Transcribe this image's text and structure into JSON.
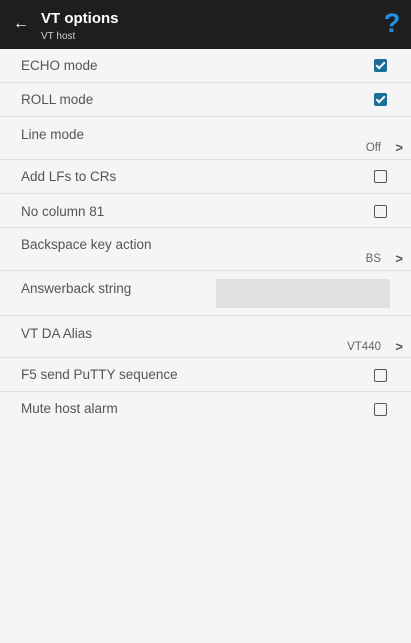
{
  "header": {
    "back_glyph": "←",
    "title": "VT options",
    "subtitle": "VT host",
    "help_glyph": "?",
    "help_color": "#1f8fe6"
  },
  "items": [
    {
      "label": "ECHO mode",
      "type": "checkbox",
      "checked": true
    },
    {
      "label": "ROLL mode",
      "type": "checkbox",
      "checked": true
    },
    {
      "label": "Line mode",
      "type": "select",
      "value": "Off",
      "chevron": ">"
    },
    {
      "label": "Add LFs to CRs",
      "type": "checkbox",
      "checked": false
    },
    {
      "label": "No column 81",
      "type": "checkbox",
      "checked": false
    },
    {
      "label": "Backspace key action",
      "type": "select",
      "value": "BS",
      "chevron": ">"
    },
    {
      "label": "Answerback string",
      "type": "text",
      "value": ""
    },
    {
      "label": "VT DA Alias",
      "type": "select",
      "value": "VT440",
      "chevron": ">"
    },
    {
      "label": "F5 send PuTTY sequence",
      "type": "checkbox",
      "checked": false
    },
    {
      "label": "Mute host alarm",
      "type": "checkbox",
      "checked": false
    }
  ],
  "colors": {
    "header_bg": "#1e1e1e",
    "checkbox_checked": "#1a6f99",
    "background": "#f5f5f5"
  }
}
